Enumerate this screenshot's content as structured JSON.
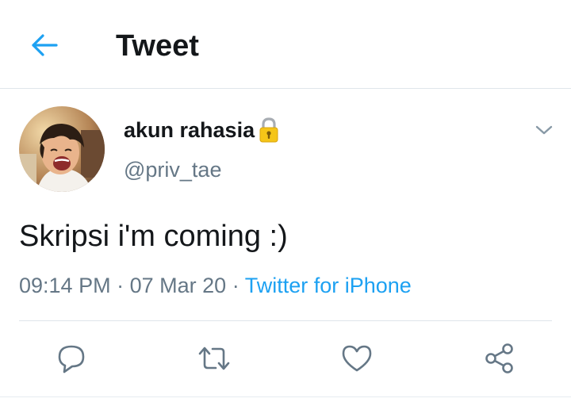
{
  "header": {
    "title": "Tweet",
    "back_icon": "arrow-left-icon",
    "accent_color": "#1da1f2"
  },
  "tweet": {
    "author_name": "akun rahasia",
    "author_handle": "@priv_tae",
    "name_emoji_icon": "lock-emoji-icon",
    "text": "Skripsi i'm coming :)",
    "time": "09:14 PM",
    "date": "07 Mar 20",
    "separator": "·",
    "source": "Twitter for iPhone",
    "menu_icon": "chevron-down-icon"
  },
  "actions": [
    {
      "name": "reply",
      "icon": "reply-icon"
    },
    {
      "name": "retweet",
      "icon": "retweet-icon"
    },
    {
      "name": "like",
      "icon": "heart-icon"
    },
    {
      "name": "share",
      "icon": "share-icon"
    }
  ],
  "colors": {
    "text_primary": "#14171a",
    "text_secondary": "#657786",
    "link": "#1da1f2",
    "icon_gray": "#657786",
    "divider": "#dfe5ea"
  }
}
